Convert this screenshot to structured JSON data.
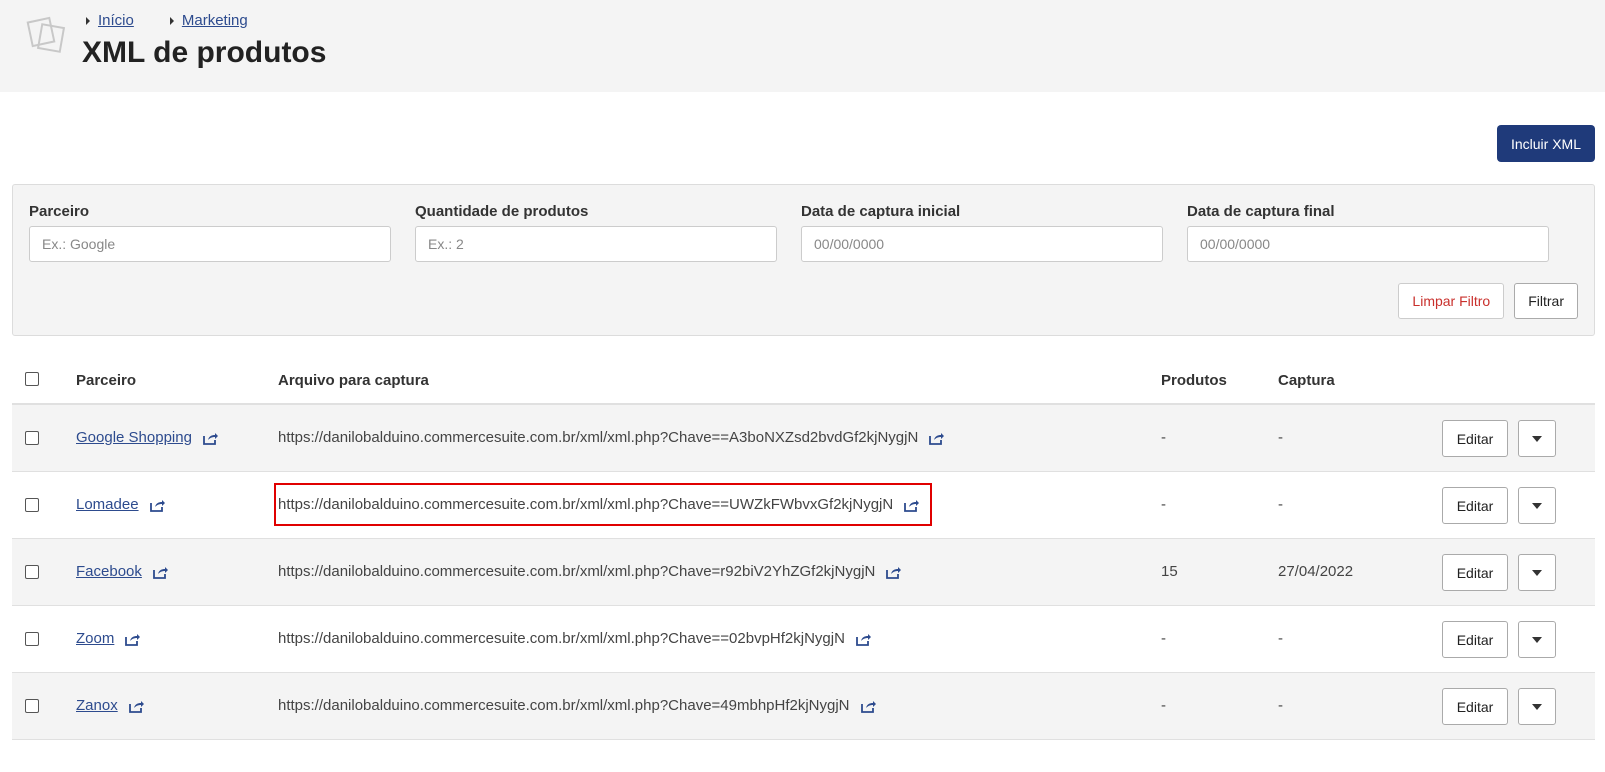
{
  "breadcrumb": [
    {
      "label": "Início"
    },
    {
      "label": "Marketing"
    }
  ],
  "page": {
    "title": "XML de produtos"
  },
  "actions": {
    "add_label": "Incluir XML"
  },
  "filters": {
    "partner": {
      "label": "Parceiro",
      "placeholder": "Ex.: Google"
    },
    "quantity": {
      "label": "Quantidade de produtos",
      "placeholder": "Ex.: 2"
    },
    "date_start": {
      "label": "Data de captura inicial",
      "placeholder": "00/00/0000"
    },
    "date_end": {
      "label": "Data de captura final",
      "placeholder": "00/00/0000"
    },
    "clear_label": "Limpar Filtro",
    "filter_label": "Filtrar"
  },
  "table": {
    "headers": {
      "partner": "Parceiro",
      "file": "Arquivo para captura",
      "products": "Produtos",
      "capture": "Captura"
    },
    "edit_label": "Editar",
    "rows": [
      {
        "partner": "Google Shopping",
        "url": "https://danilobalduino.commercesuite.com.br/xml/xml.php?Chave==A3boNXZsd2bvdGf2kjNygjN",
        "products": "-",
        "capture": "-"
      },
      {
        "partner": "Lomadee",
        "url": "https://danilobalduino.commercesuite.com.br/xml/xml.php?Chave==UWZkFWbvxGf2kjNygjN",
        "products": "-",
        "capture": "-"
      },
      {
        "partner": "Facebook",
        "url": "https://danilobalduino.commercesuite.com.br/xml/xml.php?Chave=r92biV2YhZGf2kjNygjN",
        "products": "15",
        "capture": "27/04/2022"
      },
      {
        "partner": "Zoom",
        "url": "https://danilobalduino.commercesuite.com.br/xml/xml.php?Chave==02bvpHf2kjNygjN",
        "products": "-",
        "capture": "-"
      },
      {
        "partner": "Zanox",
        "url": "https://danilobalduino.commercesuite.com.br/xml/xml.php?Chave=49mbhpHf2kjNygjN",
        "products": "-",
        "capture": "-"
      }
    ]
  },
  "colors": {
    "primary": "#1f3a7a",
    "link": "#2d4b8e",
    "danger": "#c9302c",
    "highlight": "#e00000"
  },
  "icons": {
    "logo": "stacked-squares-logo",
    "external": "share-external-icon",
    "more": "chevron-down-icon"
  }
}
